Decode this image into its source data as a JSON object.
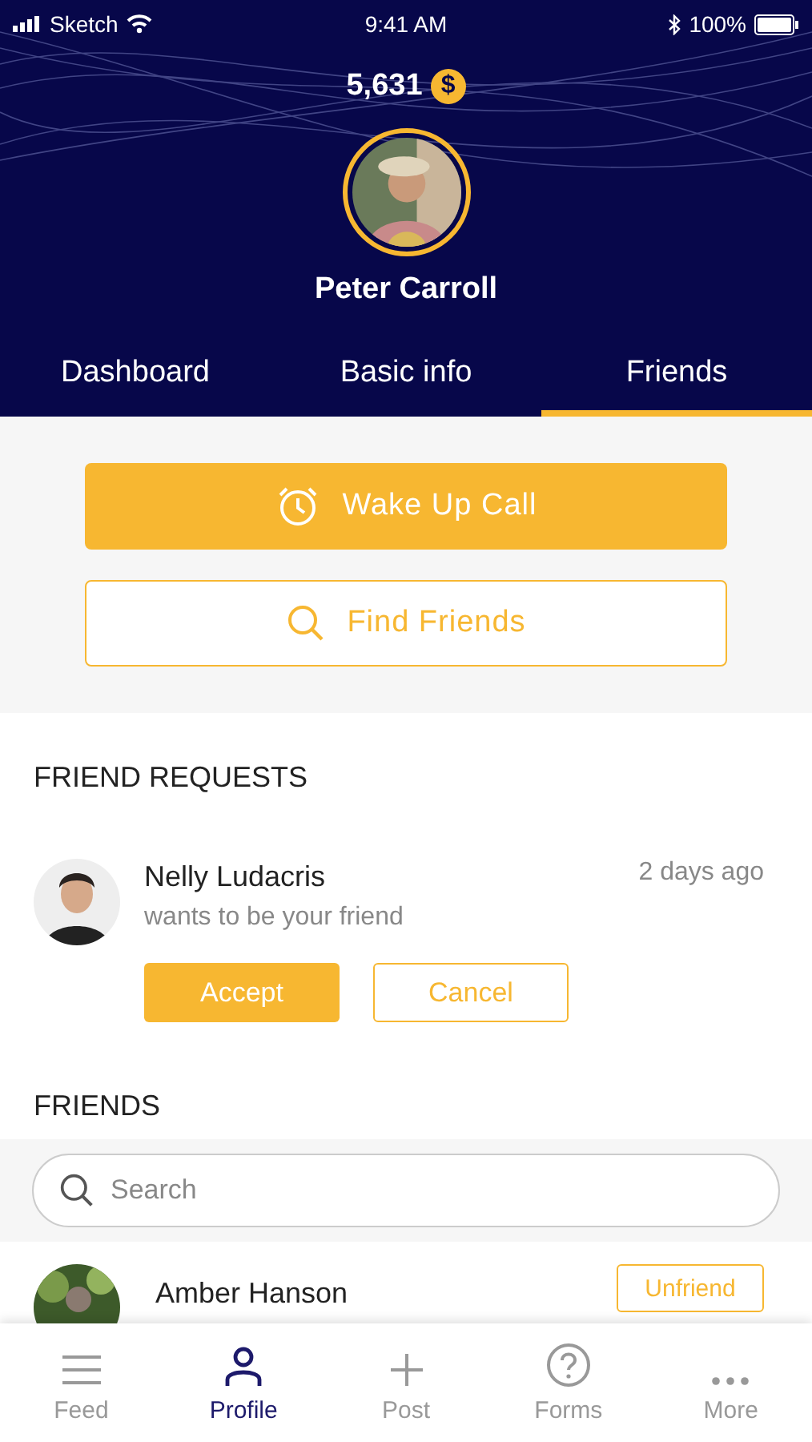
{
  "status_bar": {
    "carrier": "Sketch",
    "time": "9:41 AM",
    "battery": "100%"
  },
  "profile": {
    "coins": "5,631",
    "coin_symbol": "$",
    "name": "Peter Carroll"
  },
  "tabs": [
    {
      "label": "Dashboard",
      "selected": false
    },
    {
      "label": "Basic info",
      "selected": false
    },
    {
      "label": "Friends",
      "selected": true
    }
  ],
  "actions": [
    {
      "label": "Wake Up Call",
      "kind": "filled"
    },
    {
      "label": "Find Friends",
      "kind": "outline"
    }
  ],
  "friend_requests": {
    "title": "FRIEND REQUESTS",
    "items": [
      {
        "name": "Nelly Ludacris",
        "message": "wants to be your friend",
        "time": "2 days ago",
        "accept": "Accept",
        "cancel": "Cancel"
      }
    ]
  },
  "friends": {
    "title": "FRIENDS",
    "search": {
      "placeholder": "Search"
    },
    "items": [
      {
        "name": "Amber Hanson",
        "action": "Unfriend"
      }
    ]
  },
  "bottom_nav": [
    {
      "label": "Feed",
      "kind": "menu",
      "selected": false
    },
    {
      "label": "Profile",
      "kind": "person",
      "selected": true
    },
    {
      "label": "Post",
      "kind": "plus",
      "selected": false
    },
    {
      "label": "Forms",
      "kind": "help",
      "selected": false
    },
    {
      "label": "More",
      "kind": "more",
      "selected": false
    }
  ]
}
